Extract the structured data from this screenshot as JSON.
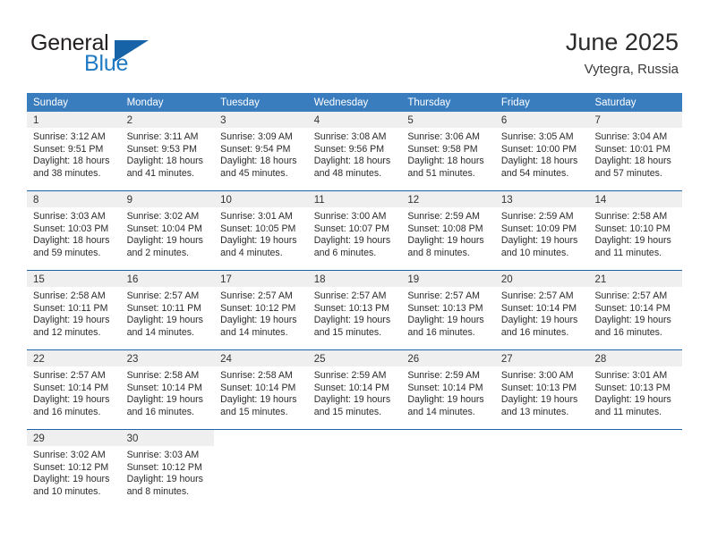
{
  "brand": {
    "name_part1": "General",
    "name_part2": "Blue",
    "triangle_color": "#1663a8",
    "blue_color": "#1f7ac4"
  },
  "header": {
    "title": "June 2025",
    "subtitle": "Vytegra, Russia"
  },
  "theme": {
    "header_blue": "#3a7dbf",
    "separator_blue": "#1e62a8",
    "daynum_bg": "#efefef",
    "text": "#2b2b2b"
  },
  "weekdays": [
    "Sunday",
    "Monday",
    "Tuesday",
    "Wednesday",
    "Thursday",
    "Friday",
    "Saturday"
  ],
  "weeks": [
    [
      {
        "day": "1",
        "sunrise": "Sunrise: 3:12 AM",
        "sunset": "Sunset: 9:51 PM",
        "daylight1": "Daylight: 18 hours",
        "daylight2": "and 38 minutes."
      },
      {
        "day": "2",
        "sunrise": "Sunrise: 3:11 AM",
        "sunset": "Sunset: 9:53 PM",
        "daylight1": "Daylight: 18 hours",
        "daylight2": "and 41 minutes."
      },
      {
        "day": "3",
        "sunrise": "Sunrise: 3:09 AM",
        "sunset": "Sunset: 9:54 PM",
        "daylight1": "Daylight: 18 hours",
        "daylight2": "and 45 minutes."
      },
      {
        "day": "4",
        "sunrise": "Sunrise: 3:08 AM",
        "sunset": "Sunset: 9:56 PM",
        "daylight1": "Daylight: 18 hours",
        "daylight2": "and 48 minutes."
      },
      {
        "day": "5",
        "sunrise": "Sunrise: 3:06 AM",
        "sunset": "Sunset: 9:58 PM",
        "daylight1": "Daylight: 18 hours",
        "daylight2": "and 51 minutes."
      },
      {
        "day": "6",
        "sunrise": "Sunrise: 3:05 AM",
        "sunset": "Sunset: 10:00 PM",
        "daylight1": "Daylight: 18 hours",
        "daylight2": "and 54 minutes."
      },
      {
        "day": "7",
        "sunrise": "Sunrise: 3:04 AM",
        "sunset": "Sunset: 10:01 PM",
        "daylight1": "Daylight: 18 hours",
        "daylight2": "and 57 minutes."
      }
    ],
    [
      {
        "day": "8",
        "sunrise": "Sunrise: 3:03 AM",
        "sunset": "Sunset: 10:03 PM",
        "daylight1": "Daylight: 18 hours",
        "daylight2": "and 59 minutes."
      },
      {
        "day": "9",
        "sunrise": "Sunrise: 3:02 AM",
        "sunset": "Sunset: 10:04 PM",
        "daylight1": "Daylight: 19 hours",
        "daylight2": "and 2 minutes."
      },
      {
        "day": "10",
        "sunrise": "Sunrise: 3:01 AM",
        "sunset": "Sunset: 10:05 PM",
        "daylight1": "Daylight: 19 hours",
        "daylight2": "and 4 minutes."
      },
      {
        "day": "11",
        "sunrise": "Sunrise: 3:00 AM",
        "sunset": "Sunset: 10:07 PM",
        "daylight1": "Daylight: 19 hours",
        "daylight2": "and 6 minutes."
      },
      {
        "day": "12",
        "sunrise": "Sunrise: 2:59 AM",
        "sunset": "Sunset: 10:08 PM",
        "daylight1": "Daylight: 19 hours",
        "daylight2": "and 8 minutes."
      },
      {
        "day": "13",
        "sunrise": "Sunrise: 2:59 AM",
        "sunset": "Sunset: 10:09 PM",
        "daylight1": "Daylight: 19 hours",
        "daylight2": "and 10 minutes."
      },
      {
        "day": "14",
        "sunrise": "Sunrise: 2:58 AM",
        "sunset": "Sunset: 10:10 PM",
        "daylight1": "Daylight: 19 hours",
        "daylight2": "and 11 minutes."
      }
    ],
    [
      {
        "day": "15",
        "sunrise": "Sunrise: 2:58 AM",
        "sunset": "Sunset: 10:11 PM",
        "daylight1": "Daylight: 19 hours",
        "daylight2": "and 12 minutes."
      },
      {
        "day": "16",
        "sunrise": "Sunrise: 2:57 AM",
        "sunset": "Sunset: 10:11 PM",
        "daylight1": "Daylight: 19 hours",
        "daylight2": "and 14 minutes."
      },
      {
        "day": "17",
        "sunrise": "Sunrise: 2:57 AM",
        "sunset": "Sunset: 10:12 PM",
        "daylight1": "Daylight: 19 hours",
        "daylight2": "and 14 minutes."
      },
      {
        "day": "18",
        "sunrise": "Sunrise: 2:57 AM",
        "sunset": "Sunset: 10:13 PM",
        "daylight1": "Daylight: 19 hours",
        "daylight2": "and 15 minutes."
      },
      {
        "day": "19",
        "sunrise": "Sunrise: 2:57 AM",
        "sunset": "Sunset: 10:13 PM",
        "daylight1": "Daylight: 19 hours",
        "daylight2": "and 16 minutes."
      },
      {
        "day": "20",
        "sunrise": "Sunrise: 2:57 AM",
        "sunset": "Sunset: 10:14 PM",
        "daylight1": "Daylight: 19 hours",
        "daylight2": "and 16 minutes."
      },
      {
        "day": "21",
        "sunrise": "Sunrise: 2:57 AM",
        "sunset": "Sunset: 10:14 PM",
        "daylight1": "Daylight: 19 hours",
        "daylight2": "and 16 minutes."
      }
    ],
    [
      {
        "day": "22",
        "sunrise": "Sunrise: 2:57 AM",
        "sunset": "Sunset: 10:14 PM",
        "daylight1": "Daylight: 19 hours",
        "daylight2": "and 16 minutes."
      },
      {
        "day": "23",
        "sunrise": "Sunrise: 2:58 AM",
        "sunset": "Sunset: 10:14 PM",
        "daylight1": "Daylight: 19 hours",
        "daylight2": "and 16 minutes."
      },
      {
        "day": "24",
        "sunrise": "Sunrise: 2:58 AM",
        "sunset": "Sunset: 10:14 PM",
        "daylight1": "Daylight: 19 hours",
        "daylight2": "and 15 minutes."
      },
      {
        "day": "25",
        "sunrise": "Sunrise: 2:59 AM",
        "sunset": "Sunset: 10:14 PM",
        "daylight1": "Daylight: 19 hours",
        "daylight2": "and 15 minutes."
      },
      {
        "day": "26",
        "sunrise": "Sunrise: 2:59 AM",
        "sunset": "Sunset: 10:14 PM",
        "daylight1": "Daylight: 19 hours",
        "daylight2": "and 14 minutes."
      },
      {
        "day": "27",
        "sunrise": "Sunrise: 3:00 AM",
        "sunset": "Sunset: 10:13 PM",
        "daylight1": "Daylight: 19 hours",
        "daylight2": "and 13 minutes."
      },
      {
        "day": "28",
        "sunrise": "Sunrise: 3:01 AM",
        "sunset": "Sunset: 10:13 PM",
        "daylight1": "Daylight: 19 hours",
        "daylight2": "and 11 minutes."
      }
    ],
    [
      {
        "day": "29",
        "sunrise": "Sunrise: 3:02 AM",
        "sunset": "Sunset: 10:12 PM",
        "daylight1": "Daylight: 19 hours",
        "daylight2": "and 10 minutes."
      },
      {
        "day": "30",
        "sunrise": "Sunrise: 3:03 AM",
        "sunset": "Sunset: 10:12 PM",
        "daylight1": "Daylight: 19 hours",
        "daylight2": "and 8 minutes."
      },
      {
        "day": "",
        "sunrise": "",
        "sunset": "",
        "daylight1": "",
        "daylight2": ""
      },
      {
        "day": "",
        "sunrise": "",
        "sunset": "",
        "daylight1": "",
        "daylight2": ""
      },
      {
        "day": "",
        "sunrise": "",
        "sunset": "",
        "daylight1": "",
        "daylight2": ""
      },
      {
        "day": "",
        "sunrise": "",
        "sunset": "",
        "daylight1": "",
        "daylight2": ""
      },
      {
        "day": "",
        "sunrise": "",
        "sunset": "",
        "daylight1": "",
        "daylight2": ""
      }
    ]
  ]
}
